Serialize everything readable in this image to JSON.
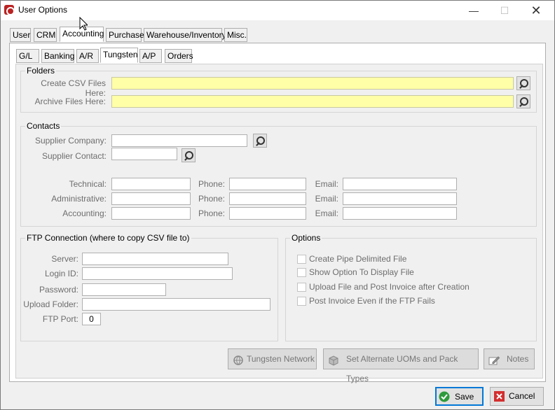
{
  "window": {
    "title": "User Options"
  },
  "tabs_top": [
    {
      "label": "User"
    },
    {
      "label": "CRM"
    },
    {
      "label": "Accounting"
    },
    {
      "label": "Purchase"
    },
    {
      "label": "Warehouse/Inventory"
    },
    {
      "label": "Misc."
    }
  ],
  "tabs_sub": [
    {
      "label": "G/L"
    },
    {
      "label": "Banking"
    },
    {
      "label": "A/R"
    },
    {
      "label": "Tungsten"
    },
    {
      "label": "A/P"
    },
    {
      "label": "Orders"
    }
  ],
  "folders": {
    "legend": "Folders",
    "csv_label": "Create CSV Files Here:",
    "csv_value": "",
    "archive_label": "Archive Files Here:",
    "archive_value": ""
  },
  "contacts": {
    "legend": "Contacts",
    "supplier_company_label": "Supplier Company:",
    "supplier_contact_label": "Supplier Contact:",
    "phone_label": "Phone:",
    "email_label": "Email:",
    "rows": [
      {
        "label": "Technical:"
      },
      {
        "label": "Administrative:"
      },
      {
        "label": "Accounting:"
      }
    ]
  },
  "ftp": {
    "legend": "FTP Connection (where to copy CSV file to)",
    "server_label": "Server:",
    "login_label": "Login ID:",
    "password_label": "Password:",
    "folder_label": "Upload Folder:",
    "port_label": "FTP Port:",
    "port_value": "0"
  },
  "options": {
    "legend": "Options",
    "items": [
      {
        "label": "Create Pipe Delimited File",
        "checked": false
      },
      {
        "label": "Show Option To Display File",
        "checked": false
      },
      {
        "label": "Upload File and Post Invoice after Creation",
        "checked": false
      },
      {
        "label": "Post Invoice Even if the FTP Fails",
        "checked": false
      }
    ]
  },
  "actions": {
    "tungsten_network": "Tungsten Network",
    "alternate_uoms": "Set Alternate UOMs and Pack Types",
    "notes": "Notes"
  },
  "footer": {
    "save": "Save",
    "cancel": "Cancel"
  }
}
